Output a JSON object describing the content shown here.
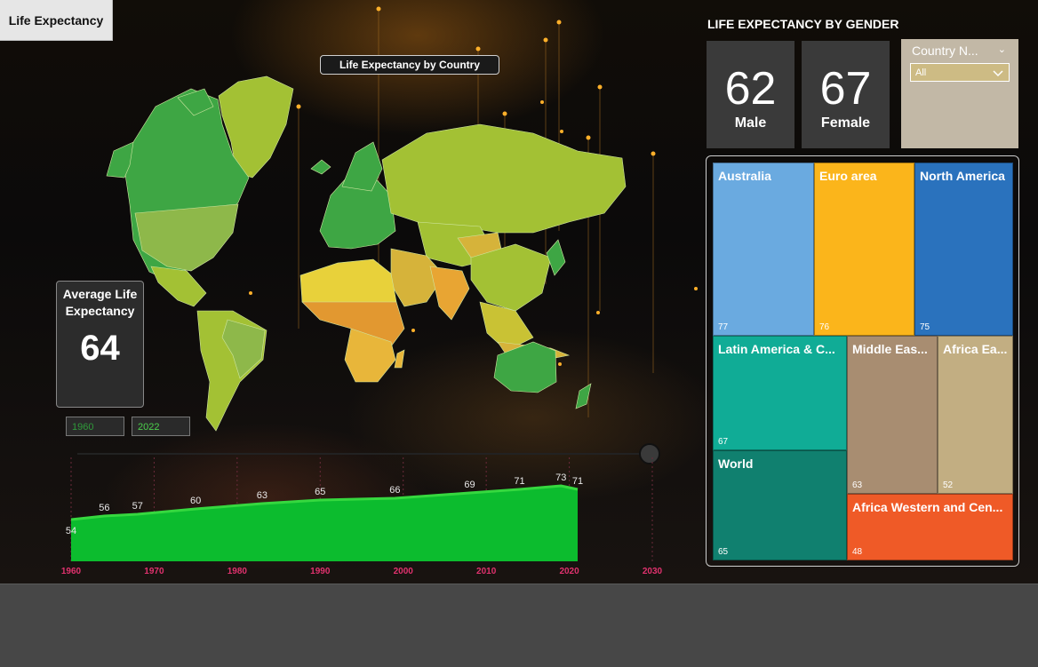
{
  "app": {
    "title": "Life Expectancy"
  },
  "map": {
    "title": "Life Expectancy by Country"
  },
  "average": {
    "label": "Average Life Expectancy",
    "value": "64"
  },
  "year_range": {
    "start": "1960",
    "end": "2022"
  },
  "gender": {
    "title": "LIFE EXPECTANCY BY GENDER",
    "male": {
      "value": "62",
      "label": "Male"
    },
    "female": {
      "value": "67",
      "label": "Female"
    }
  },
  "slicer": {
    "title": "Country N...",
    "selected": "All"
  },
  "treemap": [
    {
      "label": "Australia",
      "value": "77",
      "color": "#6aaae0"
    },
    {
      "label": "Euro area",
      "value": "76",
      "color": "#fbb51b"
    },
    {
      "label": "North America",
      "value": "75",
      "color": "#2a72bd"
    },
    {
      "label": "Latin America & C...",
      "value": "67",
      "color": "#10ac96"
    },
    {
      "label": "Middle Eas...",
      "value": "63",
      "color": "#a88d71"
    },
    {
      "label": "Africa Ea...",
      "value": "52",
      "color": "#c2ae82"
    },
    {
      "label": "World",
      "value": "65",
      "color": "#10806f"
    },
    {
      "label": "Africa Western and Cen...",
      "value": "48",
      "color": "#ef5a27"
    }
  ],
  "colors": {
    "area_fill": "#0cbc2e",
    "area_line": "#36d83f",
    "axis_label": "#e0326e"
  },
  "chart_data": {
    "type": "area",
    "x": [
      1960,
      1964,
      1968,
      1975,
      1983,
      1990,
      1999,
      2008,
      2014,
      2019,
      2021
    ],
    "values": [
      54,
      56,
      57,
      60,
      63,
      65,
      66,
      69,
      71,
      73,
      71
    ],
    "x_ticks": [
      "1960",
      "1970",
      "1980",
      "1990",
      "2000",
      "2010",
      "2020",
      "2030"
    ],
    "xlim": [
      1960,
      2030
    ],
    "grid": false
  }
}
